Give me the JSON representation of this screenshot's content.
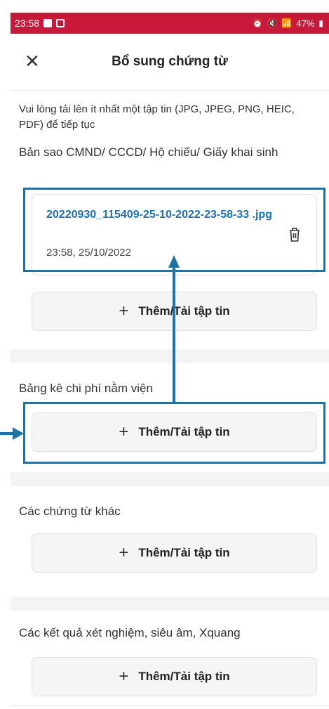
{
  "status_bar": {
    "time": "23:58",
    "battery": "47%",
    "bg_color": "#c8193a"
  },
  "header": {
    "title": "Bổ sung chứng từ",
    "close_icon": "close-icon"
  },
  "intro_note": "Vui lòng tải lên ít nhất một tập tin (JPG, JPEG, PNG, HEIC, PDF) để tiếp tục",
  "sections": [
    {
      "label": "Bản sao CMND/ CCCD/ Hộ chiếu/ Giấy khai sinh",
      "file": {
        "name": "20220930_115409-25-10-2022-23-58-33 .jpg",
        "time": "23:58, 25/10/2022",
        "delete_icon": "trash-icon"
      },
      "upload_label": "Thêm/Tải tập tin"
    },
    {
      "label": "Bảng kê chi phí nằm viện",
      "upload_label": "Thêm/Tải tập tin"
    },
    {
      "label": "Các chứng từ khác",
      "upload_label": "Thêm/Tải tập tin"
    },
    {
      "label": "Các kết quả xét nghiệm, siêu âm, Xquang",
      "upload_label": "Thêm/Tải tập tin"
    }
  ],
  "colors": {
    "accent": "#1d70b3",
    "annotation": "#1e73a6"
  }
}
